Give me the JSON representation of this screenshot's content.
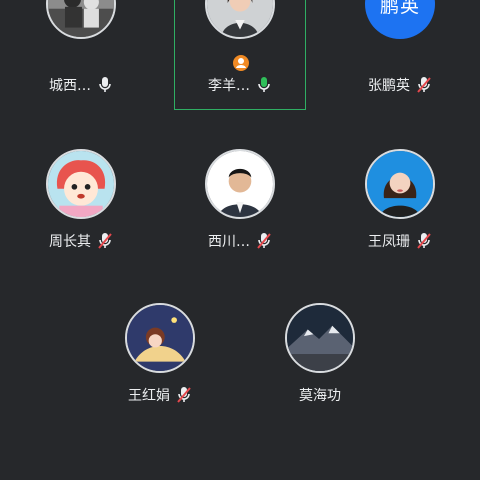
{
  "participants": [
    {
      "name": "城西…",
      "mic": "on-white",
      "avatar": "bw-photo-icon"
    },
    {
      "name": "李羊…",
      "mic": "on-green",
      "avatar": "woman-photo-icon",
      "active": true,
      "host": true
    },
    {
      "name": "张鹏英",
      "mic": "muted",
      "avatar_text": "鹏英"
    },
    {
      "name": "周长其",
      "mic": "muted",
      "avatar": "cartoon-girl-icon"
    },
    {
      "name": "西川…",
      "mic": "muted",
      "avatar": "man-photo-icon"
    },
    {
      "name": "王凤珊",
      "mic": "muted",
      "avatar": "woman-photo-blue-icon"
    },
    {
      "name": "王红娟",
      "mic": "muted",
      "avatar": "moon-girl-icon"
    },
    {
      "name": "莫海功",
      "mic": "none",
      "avatar": "mountain-night-icon"
    }
  ],
  "colors": {
    "background": "#26282b",
    "active_border": "#2fae63",
    "mic_active": "#2fbf5a",
    "mic_muted_slash": "#e5484d",
    "text_avatar_bg": "#1d73f2",
    "host_badge": "#f08a24"
  }
}
